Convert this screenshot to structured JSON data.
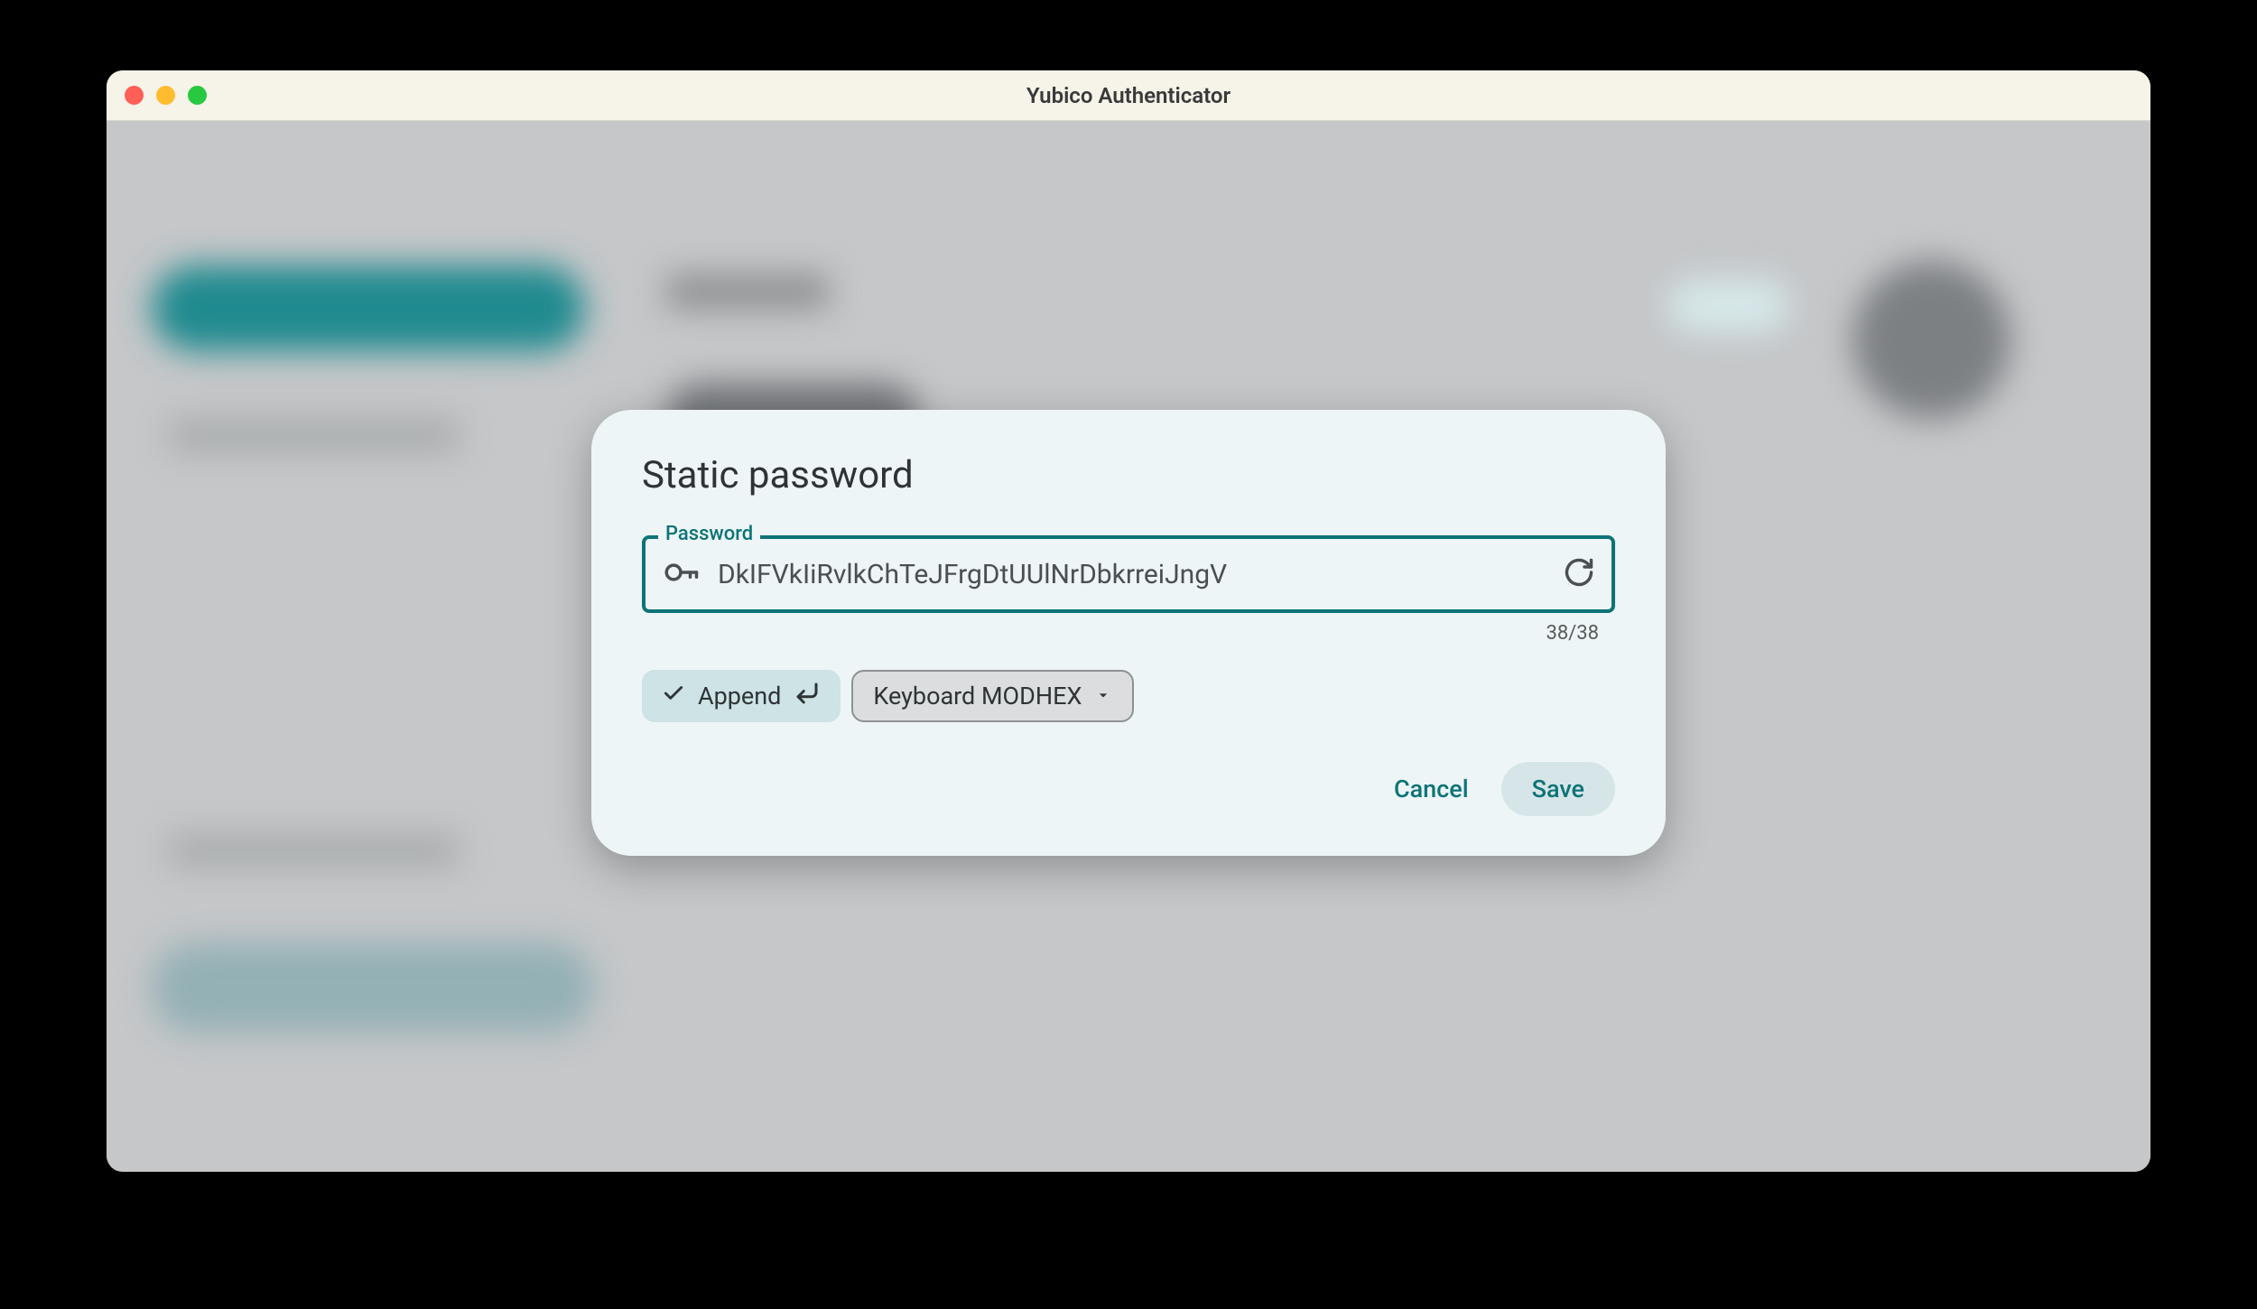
{
  "window": {
    "title": "Yubico Authenticator"
  },
  "dialog": {
    "title": "Static password",
    "password": {
      "label": "Password",
      "value": "DkIFVkIiRvlkChTeJFrgDtUUlNrDbkrreiJngV",
      "counter": "38/38"
    },
    "chips": {
      "append": "Append",
      "keyboard": "Keyboard MODHEX"
    },
    "actions": {
      "cancel": "Cancel",
      "save": "Save"
    }
  },
  "colors": {
    "accent": "#0d7377"
  }
}
